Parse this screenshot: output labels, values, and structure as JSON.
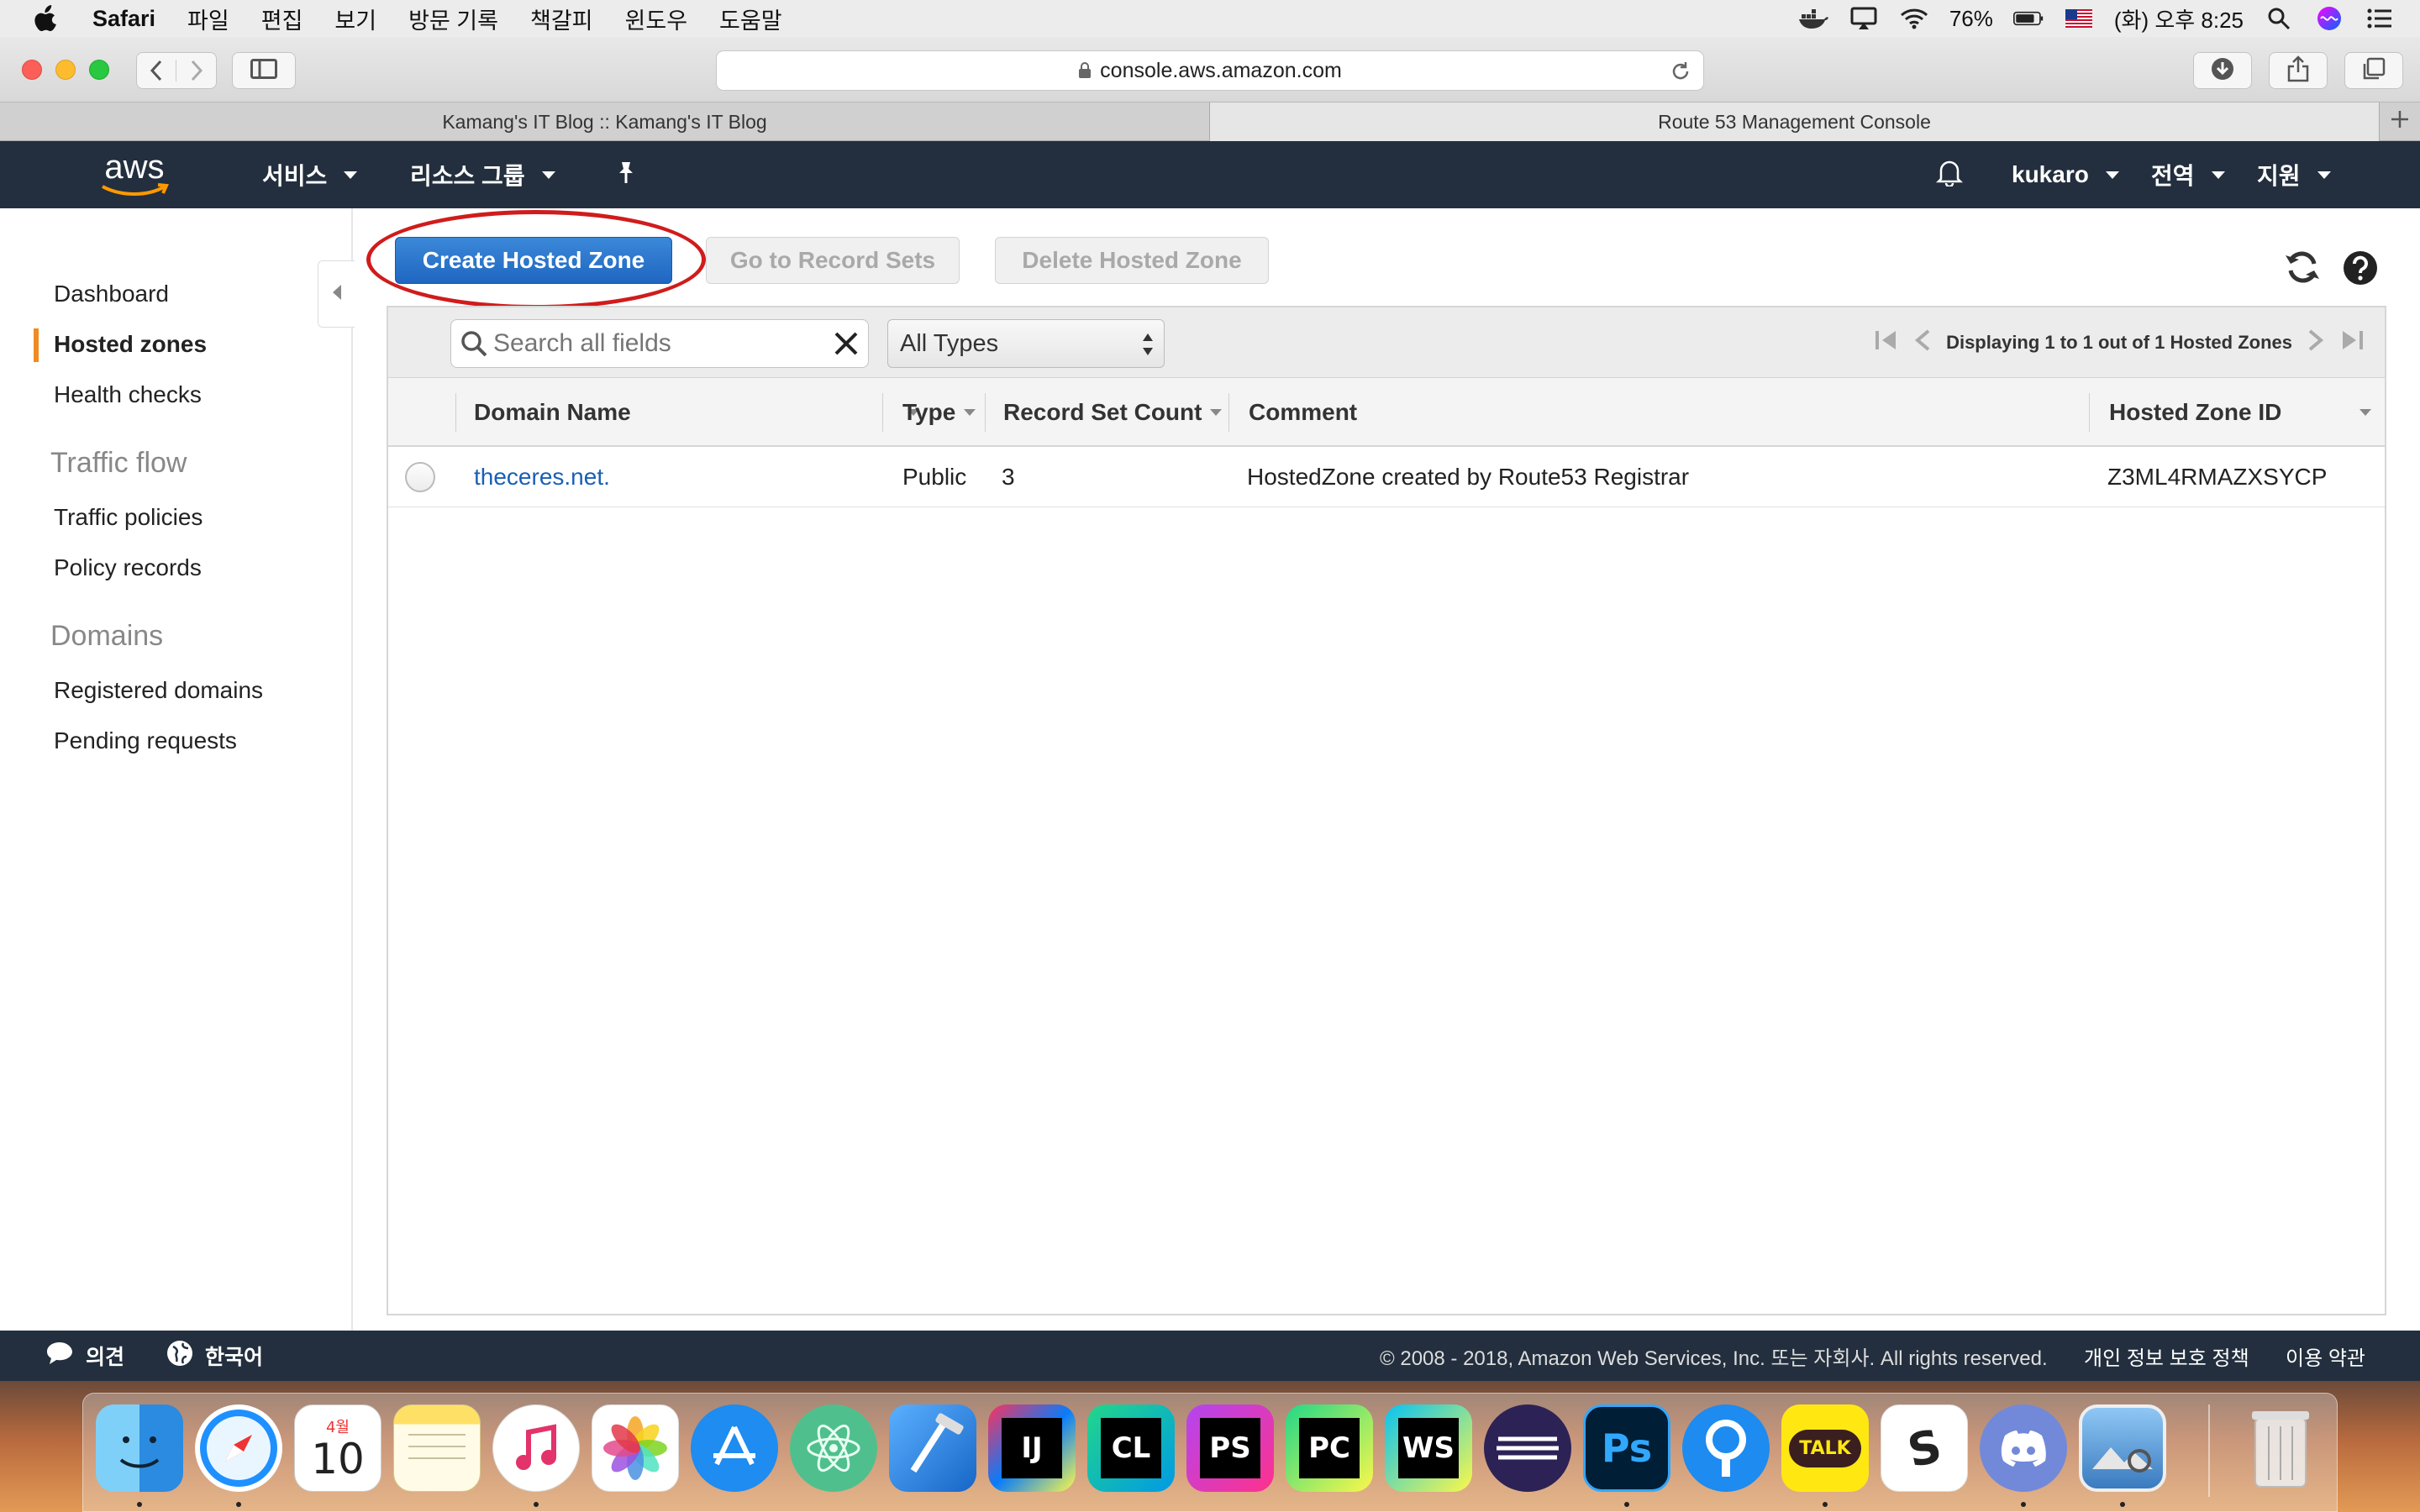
{
  "menubar": {
    "app_name": "Safari",
    "menus": [
      "파일",
      "편집",
      "보기",
      "방문 기록",
      "책갈피",
      "윈도우",
      "도움말"
    ],
    "battery": "76%",
    "clock": "(화) 오후 8:25"
  },
  "browser": {
    "url": "console.aws.amazon.com",
    "tabs": [
      {
        "title": "Kamang's IT Blog :: Kamang's IT Blog"
      },
      {
        "title": "Route 53 Management Console"
      }
    ]
  },
  "awsnav": {
    "logo": "aws",
    "services": "서비스",
    "resource_groups": "리소스 그룹",
    "user": "kukaro",
    "region": "전역",
    "support": "지원"
  },
  "sidebar": {
    "items": [
      {
        "label": "Dashboard"
      },
      {
        "label": "Hosted zones",
        "active": true
      },
      {
        "label": "Health checks"
      }
    ],
    "traffic_flow_heading": "Traffic flow",
    "traffic_items": [
      {
        "label": "Traffic policies"
      },
      {
        "label": "Policy records"
      }
    ],
    "domains_heading": "Domains",
    "domain_items": [
      {
        "label": "Registered domains"
      },
      {
        "label": "Pending requests"
      }
    ]
  },
  "actions": {
    "create": "Create Hosted Zone",
    "records": "Go to Record Sets",
    "delete": "Delete Hosted Zone"
  },
  "filter": {
    "search_placeholder": "Search all fields",
    "type_selected": "All Types",
    "pager_text": "Displaying 1 to 1 out of 1 Hosted Zones"
  },
  "table": {
    "columns": [
      "Domain Name",
      "Type",
      "Record Set Count",
      "Comment",
      "Hosted Zone ID"
    ],
    "rows": [
      {
        "domain": "theceres.net.",
        "type": "Public",
        "count": "3",
        "comment": "HostedZone created by Route53 Registrar",
        "zone_id": "Z3ML4RMAZXSYCP"
      }
    ]
  },
  "footer": {
    "feedback": "의견",
    "language": "한국어",
    "copyright": "© 2008 - 2018, Amazon Web Services, Inc. 또는 자회사. All rights reserved.",
    "privacy": "개인 정보 보호 정책",
    "terms": "이용 약관"
  },
  "dock": {
    "calendar_month": "4월",
    "calendar_day": "10",
    "apps": [
      "IJ",
      "CL",
      "PS",
      "PC",
      "WS",
      "Ps",
      "TALK",
      "S"
    ]
  },
  "colors": {
    "aws_nav": "#232f3e",
    "primary_button": "#1f66c1",
    "link": "#1a5fb4",
    "active_marker": "#f08b21",
    "highlight_circle": "#d01c1c"
  }
}
